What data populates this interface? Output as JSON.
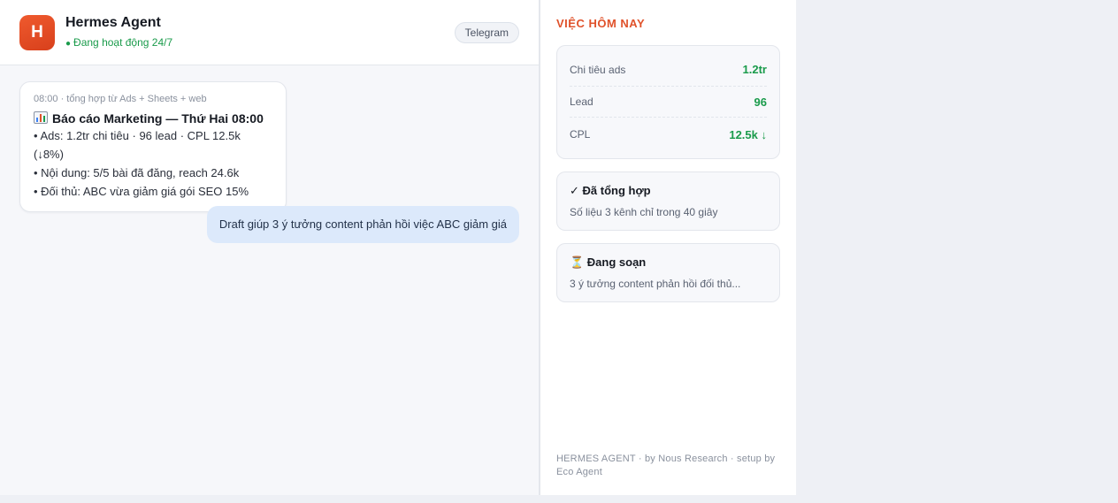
{
  "header": {
    "avatar_letter": "H",
    "agent_name": "Hermes Agent",
    "status": "Đang hoạt động 24/7",
    "channel": "Telegram"
  },
  "messages": {
    "report": {
      "meta": "08:00 · tổng hợp từ Ads + Sheets + web",
      "title": "Báo cáo Marketing — Thứ Hai 08:00",
      "lines": [
        "• Ads: 1.2tr chi tiêu · 96 lead · CPL 12.5k (↓8%)",
        "• Nội dung: 5/5 bài đã đăng, reach 24.6k",
        "• Đối thủ: ABC vừa giảm giá gói SEO 15%"
      ]
    },
    "user_message": "Draft giúp 3 ý tưởng content phản hồi việc ABC giảm giá"
  },
  "side": {
    "title": "VIỆC HÔM NAY",
    "metrics": [
      {
        "label": "Chi tiêu ads",
        "value": "1.2tr"
      },
      {
        "label": "Lead",
        "value": "96"
      },
      {
        "label": "CPL",
        "value": "12.5k ↓"
      }
    ],
    "tasks": [
      {
        "title": "✓ Đã tổng hợp",
        "desc": "Số liệu 3 kênh chỉ trong 40 giây"
      },
      {
        "title": "⏳ Đang soạn",
        "desc": "3 ý tưởng content phản hồi đối thủ..."
      }
    ],
    "footer": "HERMES AGENT · by Nous Research · setup by Eco Agent"
  },
  "colors": {
    "accent": "#e0522b",
    "status_green": "#1a9b4b",
    "user_bubble": "#dce9fb"
  },
  "icons": {
    "report_icon": "bar-chart-icon"
  }
}
